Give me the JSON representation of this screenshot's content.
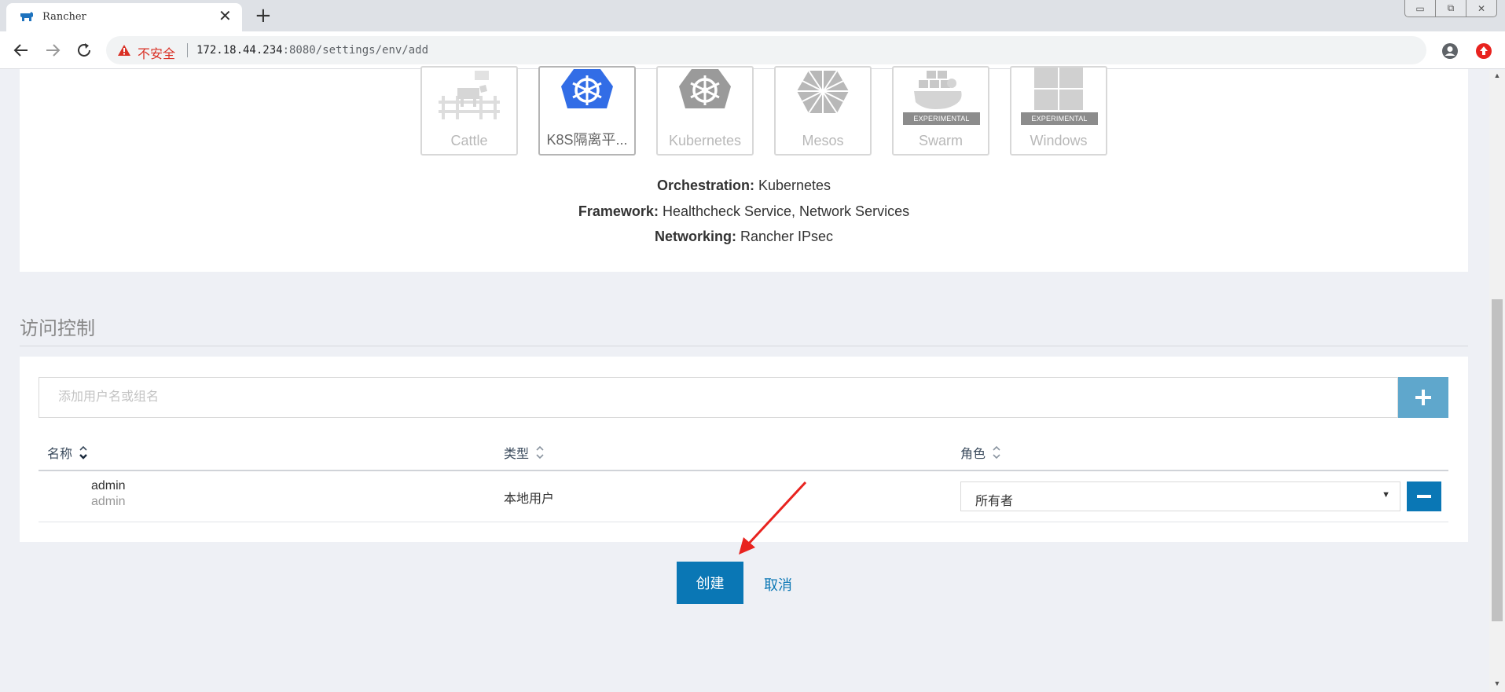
{
  "browser": {
    "tab_title": "Rancher",
    "tab_close": "✕",
    "new_tab": "+",
    "insecure_label": "不安全",
    "url_host": "172.18.44.234",
    "url_rest": ":8080/settings/env/add",
    "window_buttons": [
      "▭",
      "⧉",
      "✕"
    ]
  },
  "orchestration": {
    "tiles": [
      {
        "label": "Cattle",
        "icon": "cattle-icon",
        "experimental": false
      },
      {
        "label": "K8S隔离平...",
        "icon": "kubernetes-blue-icon",
        "experimental": false,
        "selected": true
      },
      {
        "label": "Kubernetes",
        "icon": "kubernetes-gray-icon",
        "experimental": false
      },
      {
        "label": "Mesos",
        "icon": "mesos-icon",
        "experimental": false
      },
      {
        "label": "Swarm",
        "icon": "swarm-icon",
        "experimental": true
      },
      {
        "label": "Windows",
        "icon": "windows-icon",
        "experimental": true
      }
    ],
    "experimental_badge": "EXPERIMENTAL",
    "info": {
      "orchestration_label": "Orchestration:",
      "orchestration_value": "Kubernetes",
      "framework_label": "Framework:",
      "framework_value": "Healthcheck Service, Network Services",
      "networking_label": "Networking:",
      "networking_value": "Rancher IPsec"
    }
  },
  "access": {
    "section_title": "访问控制",
    "input_placeholder": "添加用户名或组名",
    "columns": {
      "name": "名称",
      "type": "类型",
      "role": "角色"
    },
    "rows": [
      {
        "name": "admin",
        "sub": "admin",
        "type": "本地用户",
        "role": "所有者"
      }
    ]
  },
  "actions": {
    "create_label": "创建",
    "cancel_label": "取消"
  },
  "colors": {
    "primary": "#0a77b5",
    "add_button": "#5fa7cc",
    "kubernetes_blue": "#326de6",
    "annotation_red": "#e8231f"
  }
}
